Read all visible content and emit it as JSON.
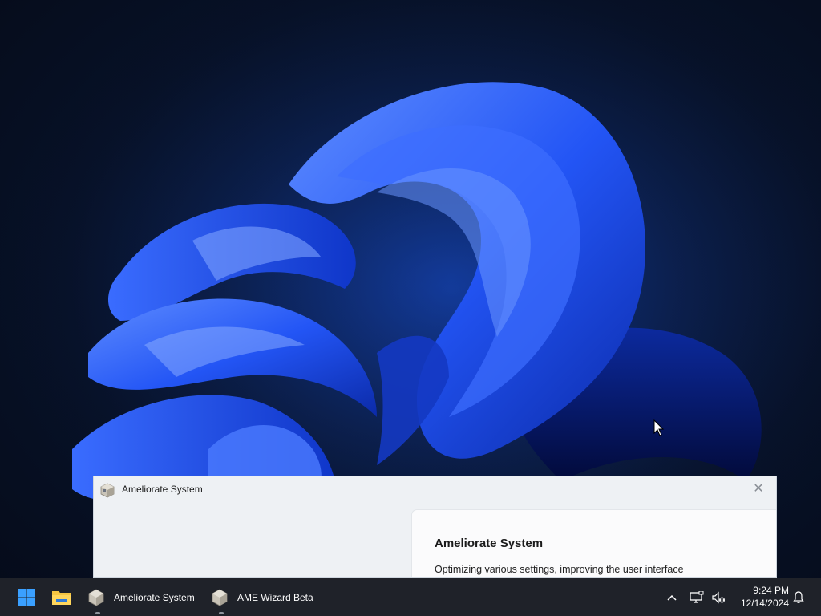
{
  "window": {
    "title": "Ameliorate System",
    "close_symbol": "✕",
    "panel": {
      "heading": "Ameliorate System",
      "description": "Optimizing various settings, improving the user interface"
    }
  },
  "taskbar": {
    "start_icon": "windows-start-icon",
    "explorer_icon": "file-explorer-icon",
    "apps": [
      {
        "label": "Ameliorate System",
        "icon": "ameliorate-app-icon"
      },
      {
        "label": "AME Wizard Beta",
        "icon": "ame-wizard-app-icon"
      }
    ],
    "tray": {
      "chevron_icon": "chevron-up-icon",
      "network_icon": "network-icon",
      "volume_icon": "volume-muted-icon",
      "time": "9:24 PM",
      "date": "12/14/2024",
      "notification_icon": "bell-icon"
    }
  },
  "colors": {
    "accent": "#1f5cff",
    "taskbar_bg": "#1f2229",
    "window_bg": "#eef1f4"
  }
}
